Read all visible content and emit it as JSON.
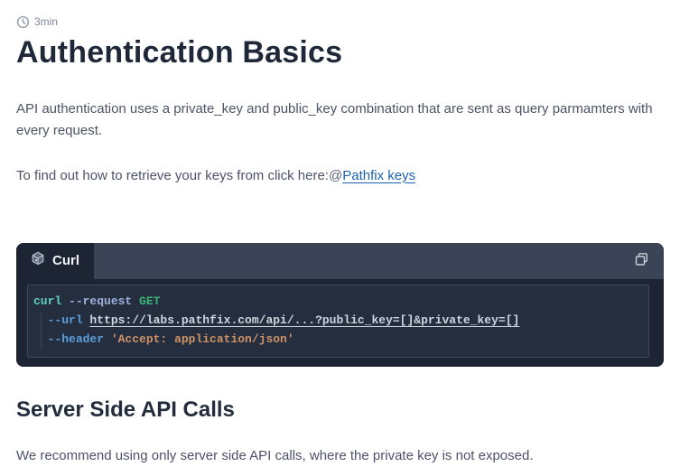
{
  "meta": {
    "read_time": "3min",
    "icon": "clock-icon"
  },
  "title": "Authentication Basics",
  "intro": "API authentication uses a private_key and public_key combination that are sent as query parmamters with every request.",
  "keys_line": {
    "prefix": "To find out how to retrieve your keys from click here:",
    "at": "@",
    "link_label": "Pathfix keys"
  },
  "code_block": {
    "tab_label": "Curl",
    "tab_icon": "package-cube-icon",
    "copy_icon": "copy-icon",
    "line1": {
      "cmd": "curl ",
      "flag": "--request ",
      "value": "GET"
    },
    "line2": {
      "indent": "  ",
      "flag": "--url ",
      "url": "https://labs.pathfix.com/api/...?public_key=[]&private_key=[]"
    },
    "line3": {
      "indent": "  ",
      "flag": "--header ",
      "string": "'Accept: application/json'"
    }
  },
  "section2": {
    "title": "Server Side API Calls",
    "body": "We recommend using only server side API calls, where the private key is not exposed."
  },
  "colors": {
    "link": "#1c63ae",
    "heading": "#1e2838",
    "body_text": "#4c5366",
    "muted": "#7d8697",
    "code_block_bg": "#1d2534",
    "code_header_bg": "#3b4456",
    "code_panel_bg": "#242e3e",
    "code_panel_border": "#3f4857",
    "syntax_command": "#5fd3c2",
    "syntax_param": "#9cb2da",
    "syntax_method": "#3db378",
    "syntax_flag": "#5c9ddb",
    "syntax_url": "#ccd4de",
    "syntax_string": "#cd9268"
  }
}
